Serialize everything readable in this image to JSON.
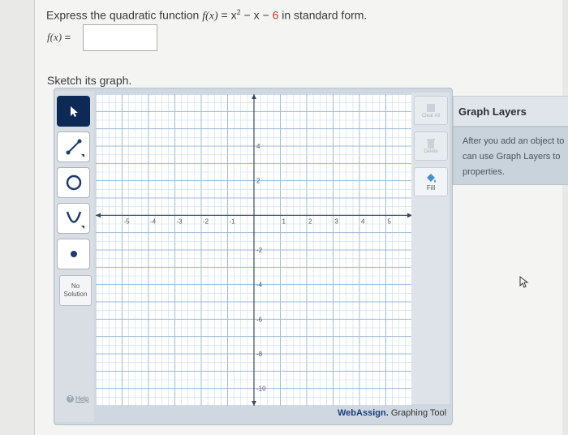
{
  "question": {
    "prefix": "Express the quadratic function",
    "fx": "f(x)",
    "equals": " = x",
    "exp": "2",
    "minus_x": " − x − ",
    "constant": "6",
    "suffix": " in standard form."
  },
  "answer": {
    "label": "f(x)",
    "equals": " =",
    "value": ""
  },
  "sketch_label": "Sketch its graph.",
  "toolbar": {
    "tools": [
      "pointer-tool",
      "line-tool",
      "circle-tool",
      "parabola-tool",
      "point-tool"
    ],
    "no_solution_line1": "No",
    "no_solution_line2": "Solution",
    "help_label": "Help"
  },
  "side_buttons": {
    "clear_label": "Clear All",
    "delete_label": "Delete",
    "fill_label": "Fill"
  },
  "brand": {
    "name": "WebAssign.",
    "suffix": " Graphing Tool"
  },
  "graph_layers": {
    "title": "Graph Layers",
    "lines": [
      "After you add an object to",
      "can use Graph Layers to",
      "properties."
    ]
  },
  "graph": {
    "x_range": [
      -6,
      6
    ],
    "y_range": [
      -11,
      7
    ],
    "x_ticks": [
      "-5",
      "-4",
      "-3",
      "-2",
      "-1",
      "1",
      "2",
      "3",
      "4",
      "5"
    ],
    "y_ticks": [
      "4",
      "2",
      "-2",
      "-4",
      "-6",
      "-8",
      "-10"
    ]
  },
  "colors": {
    "accent": "#0d2a57",
    "grid": "#b9cde3",
    "axis": "#3b4a5c",
    "constant": "#c0392b"
  }
}
